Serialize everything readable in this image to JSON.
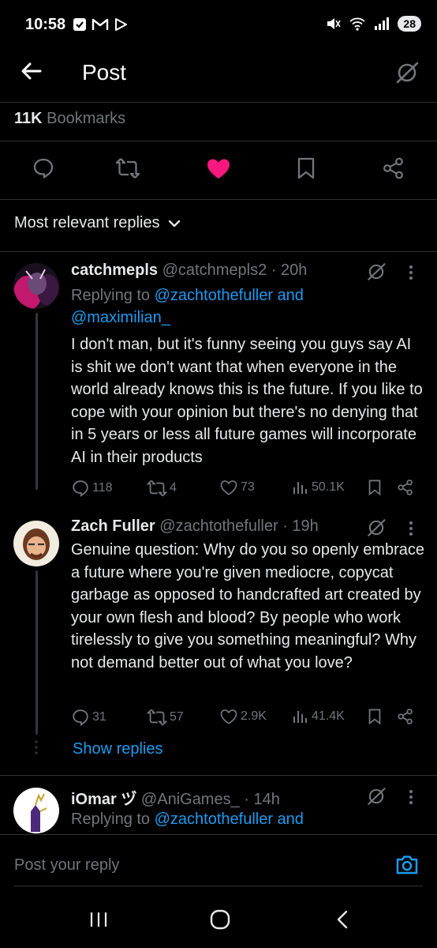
{
  "status_bar": {
    "time": "10:58",
    "battery": "28",
    "icons": [
      "check-box-icon",
      "gmail-icon",
      "play-store-icon",
      "mute-icon",
      "wifi-icon",
      "signal-icon"
    ]
  },
  "header": {
    "title": "Post",
    "back_icon": "arrow-left-icon",
    "grok_icon": "grok-icon"
  },
  "post_stats": {
    "bookmarks_count": "11K",
    "bookmarks_label": "Bookmarks"
  },
  "action_bar": {
    "icons": [
      "reply-icon",
      "repost-icon",
      "like-icon-filled",
      "bookmark-icon",
      "share-icon"
    ],
    "like_color": "#f91880"
  },
  "sort": {
    "label": "Most relevant replies"
  },
  "replies": [
    {
      "name": "catchmepls",
      "handle": "@catchmepls2",
      "time": "· 20h",
      "replying_prefix": "Replying to",
      "replying_to_1": "@zachtothefuller and",
      "replying_to_2": "@maximilian_",
      "text": "I don't man, but it's funny seeing you guys say AI is shit we don't want that when everyone in the world already knows this is the future.  If you like to cope with your opinion but there's no denying that in 5 years or less all future games will incorporate AI in their products",
      "stats": {
        "replies": "118",
        "reposts": "4",
        "likes": "73",
        "views": "50.1K"
      }
    },
    {
      "name": "Zach Fuller",
      "handle": "@zachtothefuller",
      "time": "· 19h",
      "text": "Genuine question: Why do you so openly embrace a future where you're given mediocre, copycat garbage as opposed to handcrafted art created by your own flesh and blood? By people who work tirelessly to give you something meaningful? Why not demand better out of what you love?",
      "stats": {
        "replies": "31",
        "reposts": "57",
        "likes": "2.9K",
        "views": "41.4K"
      }
    },
    {
      "name": "iOmar ヅ",
      "handle": "@AniGames_",
      "time": "· 14h",
      "replying_prefix": "Replying to",
      "replying_to_1": "@zachtothefuller and"
    }
  ],
  "show_replies": "Show replies",
  "composer": {
    "placeholder": "Post your reply",
    "camera_icon": "camera-icon"
  },
  "nav_bar": {
    "icons": [
      "recent-apps-icon",
      "home-icon",
      "back-icon"
    ]
  },
  "colors": {
    "accent": "#1d9bf0",
    "like": "#f91880",
    "muted": "#71767b",
    "text": "#e7e9ea",
    "background": "#000000"
  }
}
